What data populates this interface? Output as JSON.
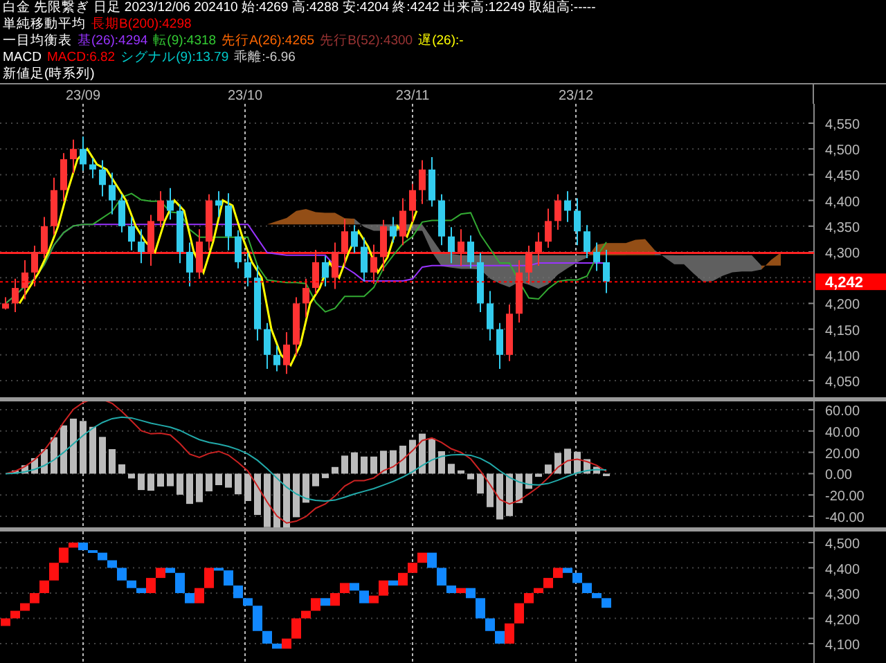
{
  "header": {
    "lines": [
      {
        "segments": [
          {
            "text": "白金 先限繋ぎ 日足 2023/12/06 202410 始:4269 高:4288 安:4204 終:4242 出来高:12249 取組高:-----",
            "color": "#ffffff"
          }
        ]
      },
      {
        "segments": [
          {
            "text": "単純移動平均",
            "color": "#ffffff"
          },
          {
            "text": "長期B(200):4298",
            "color": "#ff0000"
          }
        ]
      },
      {
        "segments": [
          {
            "text": "一目均衡表",
            "color": "#ffffff"
          },
          {
            "text": "基(26):4294",
            "color": "#9933ff"
          },
          {
            "text": "転(9):4318",
            "color": "#33cc33"
          },
          {
            "text": "先行A(26):4265",
            "color": "#ff6600"
          },
          {
            "text": "先行B(52):4300",
            "color": "#993333"
          },
          {
            "text": "遅(26):-",
            "color": "#ffff00"
          }
        ]
      },
      {
        "segments": [
          {
            "text": "MACD",
            "color": "#ffffff"
          },
          {
            "text": "MACD:6.82",
            "color": "#ff0000"
          },
          {
            "text": "シグナル(9):13.79",
            "color": "#00cccc"
          },
          {
            "text": "乖離:-6.96",
            "color": "#cccccc"
          }
        ]
      },
      {
        "segments": [
          {
            "text": "新値足(時系列)",
            "color": "#ffffff"
          }
        ]
      }
    ]
  },
  "date_axis": {
    "labels": [
      "23/09",
      "23/10",
      "23/11",
      "23/12"
    ]
  },
  "price_chart": {
    "y_ticks": [
      "4,550",
      "4,500",
      "4,450",
      "4,400",
      "4,350",
      "4,300",
      "4,200",
      "4,150",
      "4,100",
      "4,050"
    ],
    "current_price": "4,242"
  },
  "macd_chart": {
    "y_ticks": [
      "60.00",
      "40.00",
      "20.00",
      "0.00",
      "-20.00",
      "-40.00"
    ]
  },
  "new_price_chart": {
    "y_ticks": [
      "4,500",
      "4,400",
      "4,300",
      "4,200",
      "4,100"
    ]
  }
}
